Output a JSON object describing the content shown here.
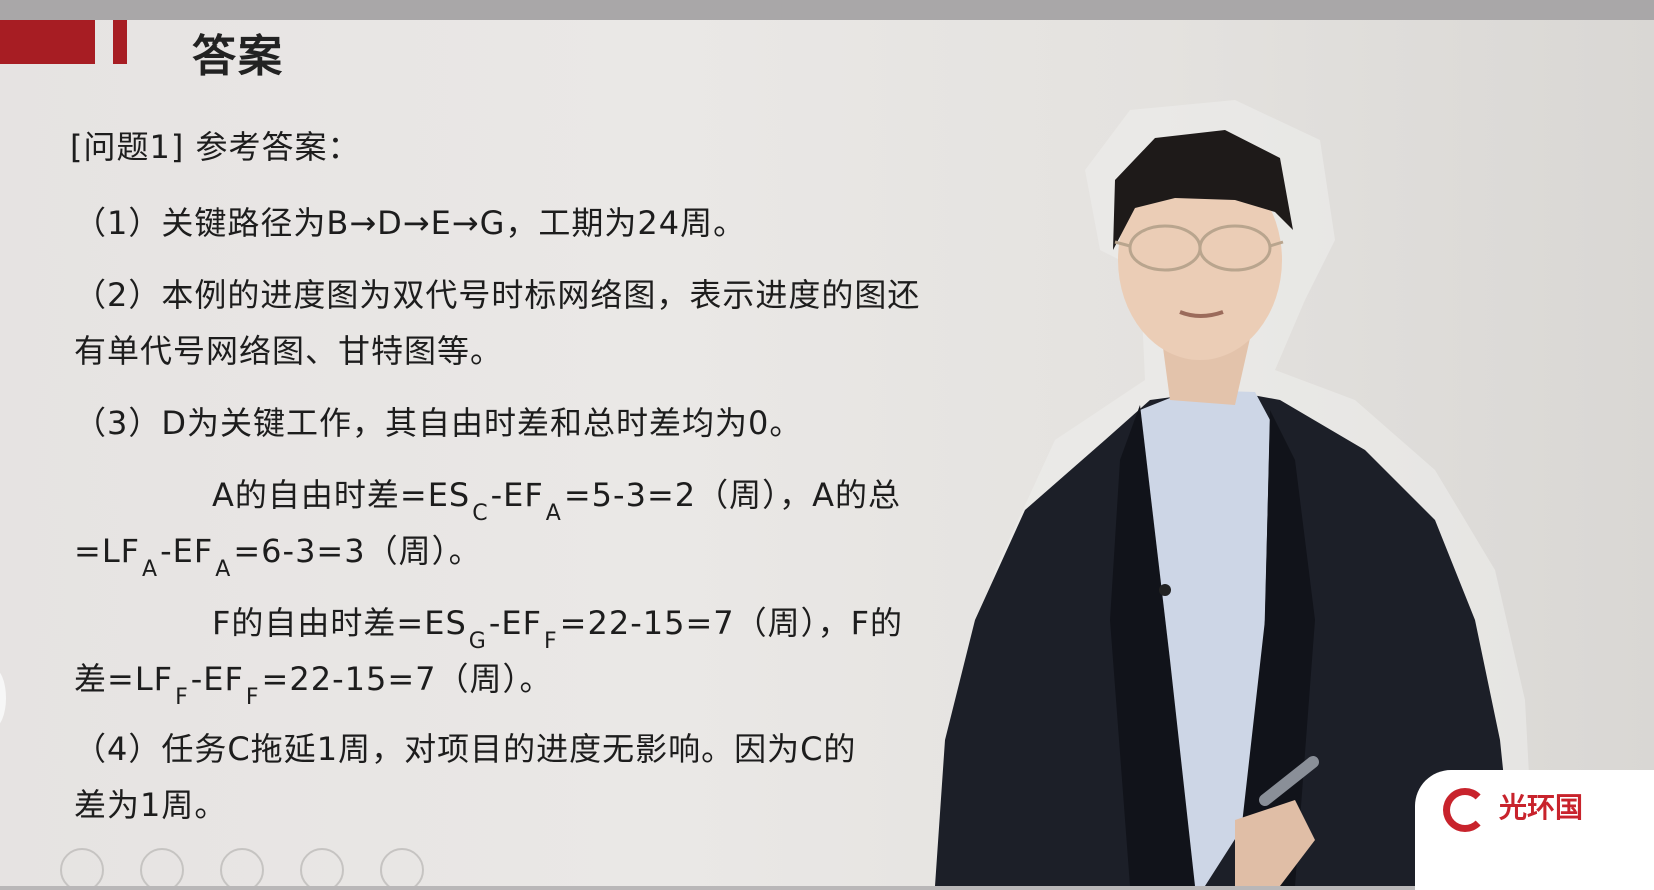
{
  "slide": {
    "title": "答案",
    "heading": "[问题1] 参考答案：",
    "p1": "（1）关键路径为B→D→E→G，工期为24周。",
    "p2a": "（2）本例的进度图为双代号时标网络图，表示进度的图还",
    "p2b": "有单代号网络图、甘特图等。",
    "p3": "（3）D为关键工作，其自由时差和总时差均为0。",
    "line_a1": {
      "prefix": "A的自由时差=ES",
      "sub1": "C",
      "mid": "-EF",
      "sub2": "A",
      "suffix": "=5-3=2（周），A的总"
    },
    "line_a2": {
      "prefix": "=LF",
      "sub1": "A",
      "mid": "-EF",
      "sub2": "A",
      "suffix": "=6-3=3（周）。"
    },
    "line_f1": {
      "prefix": "F的自由时差=ES",
      "sub1": "G",
      "mid": "-EF",
      "sub2": "F",
      "suffix": "=22-15=7（周），F的"
    },
    "line_f2": {
      "prefix": "差=LF",
      "sub1": "F",
      "mid": "-EF",
      "sub2": "F",
      "suffix": "=22-15=7（周）。"
    },
    "p4a": "（4）任务C拖延1周，对项目的进度无影响。因为C的",
    "p4b": "差为1周。"
  },
  "logo": {
    "text": "光环国"
  },
  "colors": {
    "accent": "#a71d23",
    "logo": "#c8232c"
  }
}
